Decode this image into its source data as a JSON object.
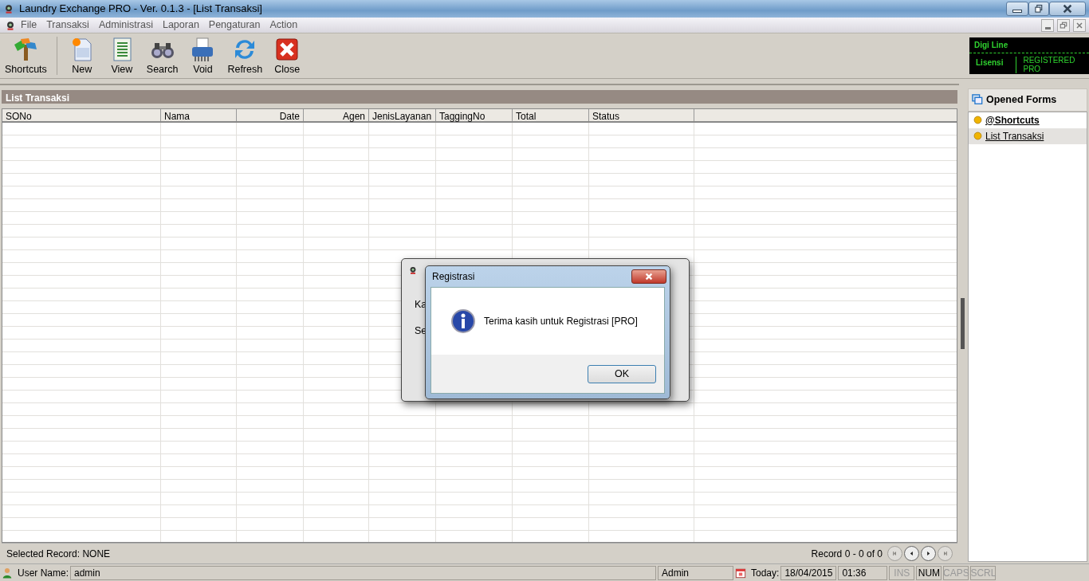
{
  "window": {
    "title": "Laundry Exchange PRO - Ver. 0.1.3 - [List Transaksi]"
  },
  "menu": [
    "File",
    "Transaksi",
    "Administrasi",
    "Laporan",
    "Pengaturan",
    "Action"
  ],
  "toolbar": [
    {
      "label": "Shortcuts",
      "kind": "shortcuts"
    },
    {
      "label": "New",
      "kind": "new"
    },
    {
      "label": "View",
      "kind": "view"
    },
    {
      "label": "Search",
      "kind": "search"
    },
    {
      "label": "Void",
      "kind": "void"
    },
    {
      "label": "Refresh",
      "kind": "refresh"
    },
    {
      "label": "Close",
      "kind": "close"
    }
  ],
  "license": {
    "product": "Digi Line",
    "label": "Lisensi",
    "value": "REGISTERED PRO"
  },
  "list": {
    "title": "List Transaksi",
    "columns": [
      {
        "label": "SONo",
        "kind": "text"
      },
      {
        "label": "Nama",
        "kind": "text"
      },
      {
        "label": "Date",
        "kind": "numeric"
      },
      {
        "label": "Agen",
        "kind": "numeric"
      },
      {
        "label": "JenisLayanan",
        "kind": "text"
      },
      {
        "label": "TaggingNo",
        "kind": "text"
      },
      {
        "label": "Total",
        "kind": "text"
      },
      {
        "label": "Status",
        "kind": "text"
      }
    ],
    "selected_record": "Selected Record: NONE",
    "record_count": "Record 0 - 0 of 0",
    "nav": [
      {
        "kind": "first",
        "disabled": true
      },
      {
        "kind": "prev",
        "disabled": false
      },
      {
        "kind": "next",
        "disabled": false
      },
      {
        "kind": "last",
        "disabled": true
      }
    ]
  },
  "opened_forms": {
    "title": "Opened Forms",
    "items": [
      {
        "label": "@Shortcuts",
        "kind": "shortcut",
        "selected": false
      },
      {
        "label": "List Transaksi",
        "kind": "form",
        "selected": true
      }
    ]
  },
  "back_dialog": {
    "labels": [
      "Ka",
      "Se"
    ]
  },
  "dialog": {
    "title": "Registrasi",
    "message": "Terima kasih untuk Registrasi [PRO]",
    "button": "OK"
  },
  "status_bar": {
    "user_label": "User Name:",
    "user": "admin",
    "role": "Admin",
    "today_label": "Today:",
    "date": "18/04/2015",
    "time": "01:36",
    "keys": [
      {
        "label": "INS",
        "on": false
      },
      {
        "label": "NUM",
        "on": true
      },
      {
        "label": "CAPS",
        "on": false
      },
      {
        "label": "SCRL",
        "on": false
      }
    ]
  }
}
